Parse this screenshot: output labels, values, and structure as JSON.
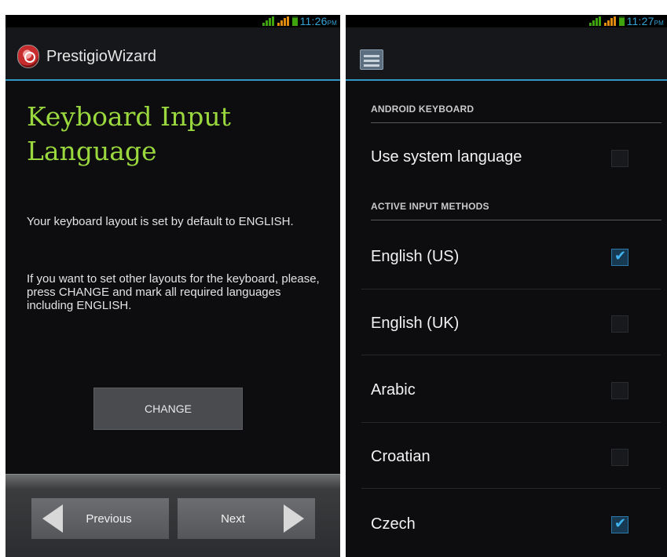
{
  "left_screen": {
    "status": {
      "time": "11:26",
      "ampm": "PM"
    },
    "app_title": "PrestigioWizard",
    "heading": "Keyboard Input Language",
    "text1": "Your keyboard layout is set by default to ENGLISH.",
    "text2": "If you want to set other layouts for the keyboard, please, press CHANGE and mark all required languages including ENGLISH.",
    "change_button": "CHANGE",
    "previous_button": "Previous",
    "next_button": "Next"
  },
  "right_screen": {
    "status": {
      "time": "11:27",
      "ampm": "PM"
    },
    "section_android": "ANDROID KEYBOARD",
    "use_system_language": {
      "label": "Use system language",
      "checked": false
    },
    "section_active": "ACTIVE INPUT METHODS",
    "languages": [
      {
        "label": "English (US)",
        "checked": true
      },
      {
        "label": "English (UK)",
        "checked": false
      },
      {
        "label": "Arabic",
        "checked": false
      },
      {
        "label": "Croatian",
        "checked": false
      },
      {
        "label": "Czech",
        "checked": true
      }
    ]
  },
  "colors": {
    "accent_blue": "#34a3d8",
    "heading_green": "#9ad83e",
    "check_blue": "#3fb4f0"
  }
}
